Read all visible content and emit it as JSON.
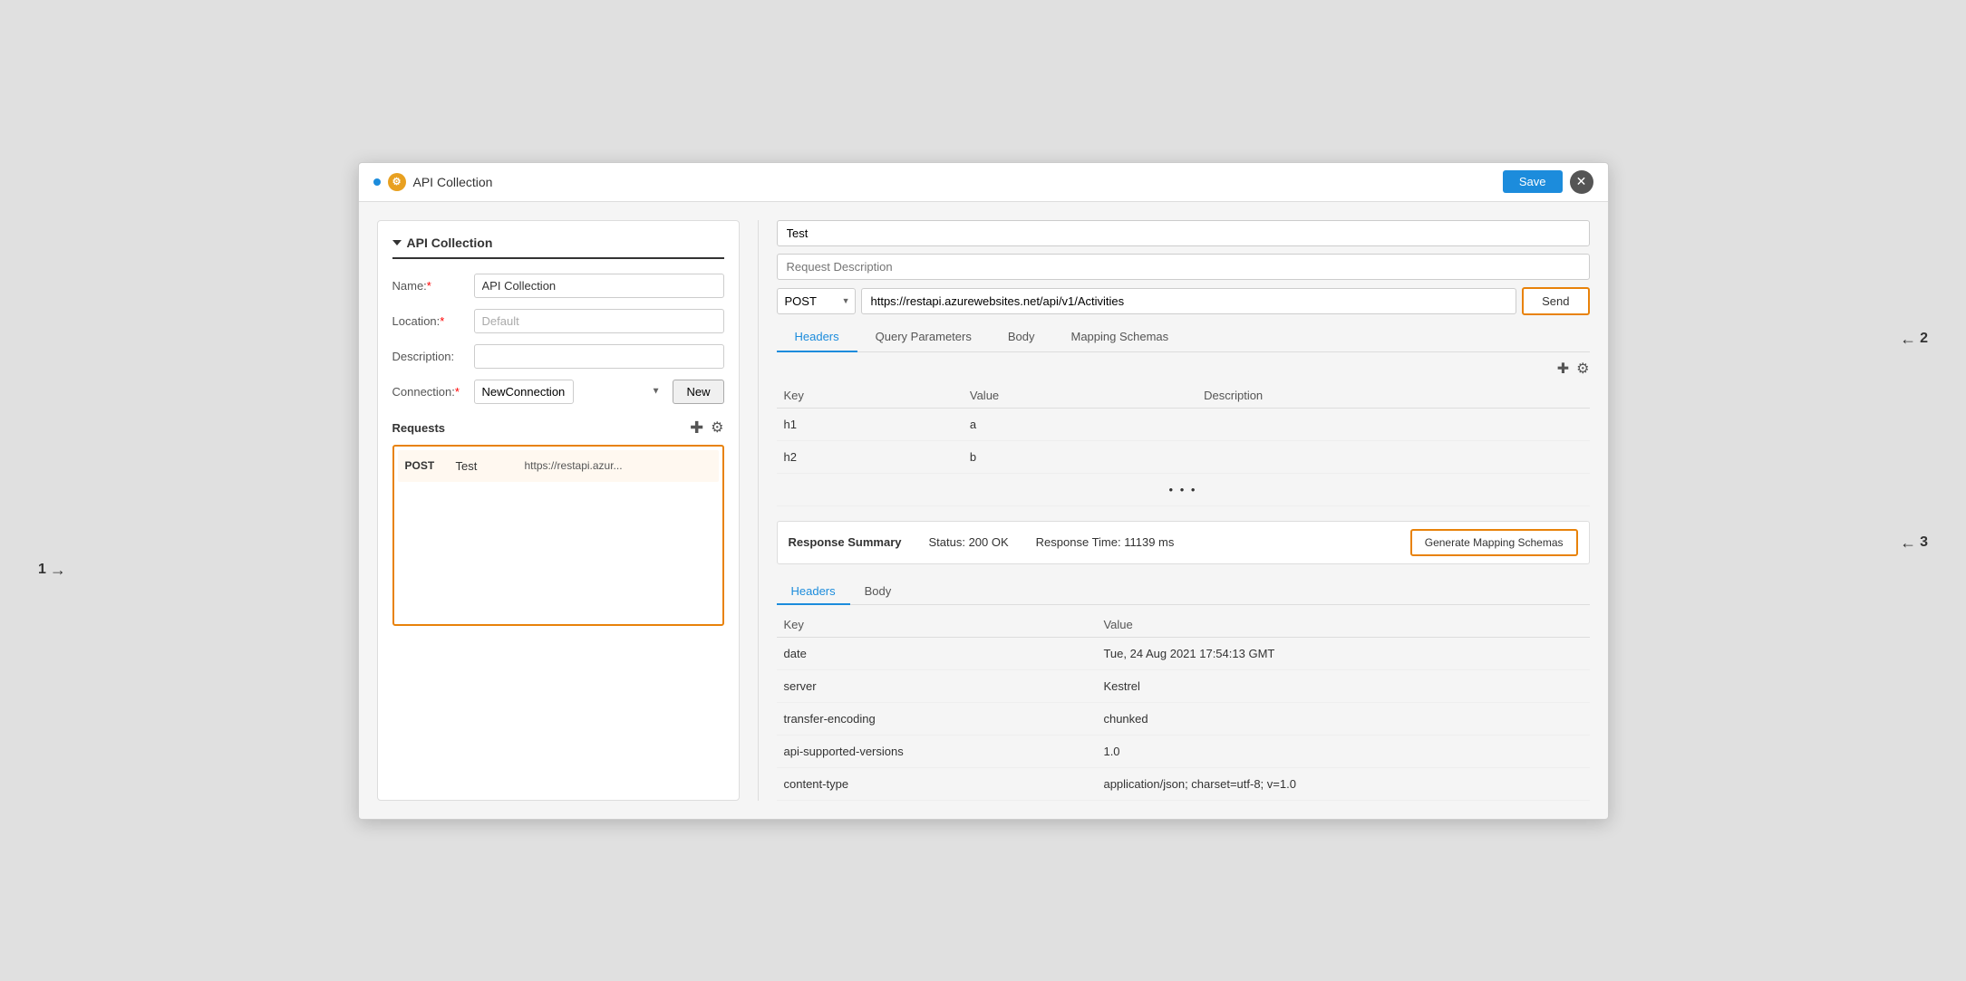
{
  "window": {
    "title": "API Collection",
    "save_label": "Save",
    "close_icon": "✕"
  },
  "left_panel": {
    "section_title": "API Collection",
    "fields": {
      "name_label": "Name:",
      "name_required": "*",
      "name_value": "API Collection",
      "location_label": "Location:",
      "location_required": "*",
      "location_placeholder": "Default",
      "description_label": "Description:",
      "connection_label": "Connection:",
      "connection_required": "*",
      "connection_value": "NewConnection",
      "new_button": "New"
    },
    "requests": {
      "title": "Requests",
      "items": [
        {
          "method": "POST",
          "name": "Test",
          "url": "https://restapi.azur..."
        }
      ]
    }
  },
  "right_panel": {
    "request_name": "Test",
    "request_desc_placeholder": "Request Description",
    "method": "POST",
    "url": "https://restapi.azurewebsites.net/api/v1/Activities",
    "send_label": "Send",
    "tabs": [
      "Headers",
      "Query Parameters",
      "Body",
      "Mapping Schemas"
    ],
    "active_tab": "Headers",
    "headers_table": {
      "columns": [
        "Key",
        "Value",
        "Description"
      ],
      "rows": [
        {
          "key": "h1",
          "value": "a",
          "description": ""
        },
        {
          "key": "h2",
          "value": "b",
          "description": ""
        }
      ]
    },
    "response": {
      "label": "Response Summary",
      "status": "Status: 200 OK",
      "time": "Response Time: 11139 ms",
      "generate_label": "Generate Mapping Schemas",
      "tabs": [
        "Headers",
        "Body"
      ],
      "active_tab": "Headers",
      "table": {
        "columns": [
          "Key",
          "Value"
        ],
        "rows": [
          {
            "key": "date",
            "value": "Tue, 24 Aug 2021 17:54:13 GMT"
          },
          {
            "key": "server",
            "value": "Kestrel"
          },
          {
            "key": "transfer-encoding",
            "value": "chunked"
          },
          {
            "key": "api-supported-versions",
            "value": "1.0"
          },
          {
            "key": "content-type",
            "value": "application/json; charset=utf-8; v=1.0"
          }
        ]
      }
    }
  },
  "annotations": {
    "label_1": "1",
    "label_2": "2",
    "label_3": "3"
  }
}
